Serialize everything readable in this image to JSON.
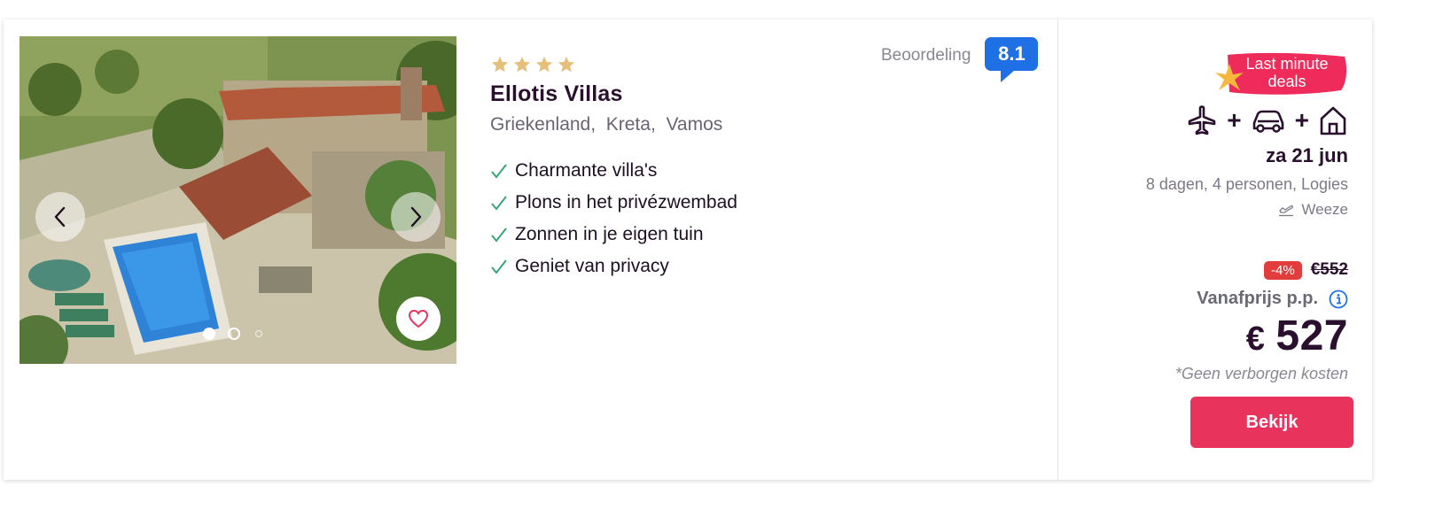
{
  "hotel": {
    "name": "Ellotis Villas",
    "stars": 4,
    "location": [
      "Griekenland,",
      "Kreta,",
      "Vamos"
    ],
    "usps": [
      "Charmante villa's",
      "Plons in het privézwembad",
      "Zonnen in je eigen tuin",
      "Geniet van privacy"
    ]
  },
  "rating": {
    "label": "Beoordeling",
    "score": "8.1"
  },
  "gallery": {
    "slide_count": 3,
    "active_index": 0
  },
  "deal": {
    "label": "Last minute deals"
  },
  "trip": {
    "icons": [
      "plane-icon",
      "car-icon",
      "house-icon"
    ],
    "plus": "+",
    "date": "za 21 jun",
    "details": "8 dagen, 4 personen, Logies",
    "airport": "Weeze"
  },
  "pricing": {
    "discount": "-4%",
    "old_price": "€552",
    "from_label": "Vanafprijs p.p.",
    "currency": "€",
    "price": "527",
    "note": "*Geen verborgen kosten",
    "cta": "Bekijk"
  },
  "colors": {
    "brand_pink": "#e8335d",
    "rating_blue": "#1f6fe5",
    "star_gold": "#e5c07b",
    "check_green": "#3aa673",
    "discount_red": "#e23d3d"
  }
}
